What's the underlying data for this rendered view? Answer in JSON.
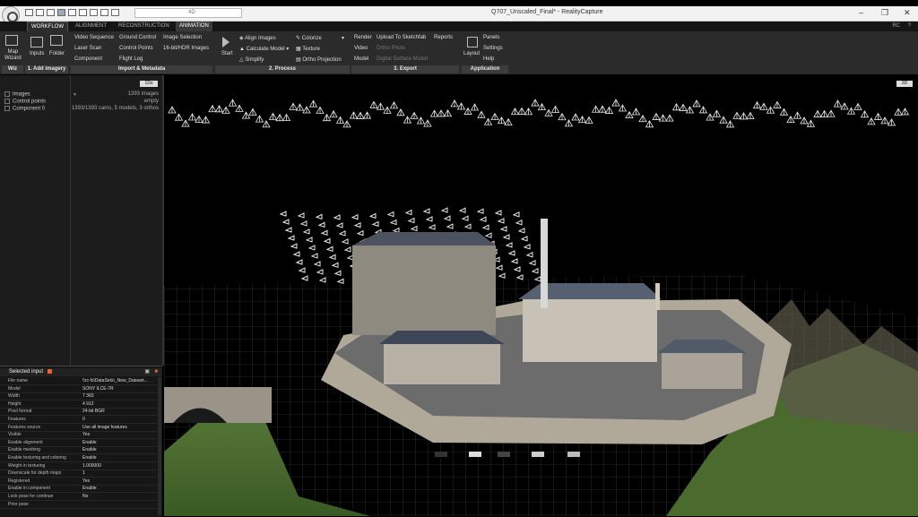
{
  "window": {
    "title": "Q707_Unscaled_Final* - RealityCapture",
    "search_value": "",
    "view_mode": "4D"
  },
  "menu": {
    "tabs": [
      {
        "label": "WORKFLOW",
        "active": true
      },
      {
        "label": "ALIGNMENT",
        "active": false
      },
      {
        "label": "RECONSTRUCTION",
        "active": false
      },
      {
        "label": "ANIMATION",
        "active": false
      }
    ],
    "user_label": "RC"
  },
  "ribbon": {
    "wiz": {
      "map_wizard": "Map\nWizard",
      "group": "Wiz"
    },
    "add_imagery": {
      "inputs": "Inputs",
      "folder": "Folder",
      "group": "1. Add imagery"
    },
    "import_metadata": {
      "items": [
        "Video Sequence",
        "Laser Scan",
        "Component",
        "Ground Control",
        "Control Points",
        "Flight Log",
        "Image Selection",
        "16-bit/HDR Images"
      ],
      "group": "Import & Metadata"
    },
    "process": {
      "start": "Start",
      "items": [
        "Align Images",
        "Calculate Model",
        "Simplify",
        "Colorize",
        "Texture",
        "Ortho Projection"
      ],
      "group": "2. Process"
    },
    "export": {
      "items": [
        "Render",
        "Video",
        "Model",
        "Upload To Sketchfab",
        "Ortho Photo",
        "Digital Surface Model",
        "Reports"
      ],
      "group": "3. Export"
    },
    "application": {
      "layout": "Layout",
      "items": [
        "Panels",
        "Settings",
        "Help"
      ],
      "group": "Application"
    }
  },
  "project_tree": {
    "view_button": "1Ds",
    "items": [
      {
        "label": "Images",
        "value": "1393 images"
      },
      {
        "label": "Control points",
        "value": "empty"
      },
      {
        "label": "Component 0",
        "value": "1393/1393 cams, 5 models, 3 orthos"
      }
    ]
  },
  "selected_input": {
    "title": "Selected input",
    "properties": [
      {
        "key": "File name",
        "value": "\\\\rc-fs\\DataSets\\_New_Dataset..."
      },
      {
        "key": "Model",
        "value": "SONY ILCE-7R"
      },
      {
        "key": "Width",
        "value": "7 360"
      },
      {
        "key": "Height",
        "value": "4 912"
      },
      {
        "key": "Pixel format",
        "value": "24-bit BGR"
      },
      {
        "key": "Features",
        "value": "0"
      },
      {
        "key": "Features source",
        "value": "Use all image features"
      },
      {
        "key": "Visible",
        "value": "Yes"
      },
      {
        "key": "Enable alignment",
        "value": "Enable"
      },
      {
        "key": "Enable meshing",
        "value": "Enable"
      },
      {
        "key": "Enable texturing and coloring",
        "value": "Enable"
      },
      {
        "key": "Weight in texturing",
        "value": "1.000000"
      },
      {
        "key": "Downscale for depth maps",
        "value": "1"
      },
      {
        "key": "Registered",
        "value": "Yes"
      },
      {
        "key": "Enable in component",
        "value": "Enable"
      },
      {
        "key": "Lock pose for continue",
        "value": "No"
      },
      {
        "key": "Prior pose",
        "value": ""
      }
    ]
  },
  "viewport": {
    "mode_button": "3D",
    "colors": {
      "background": "#000000",
      "grid": "#5a5a5a",
      "cameras": "#e8e8e8"
    }
  }
}
